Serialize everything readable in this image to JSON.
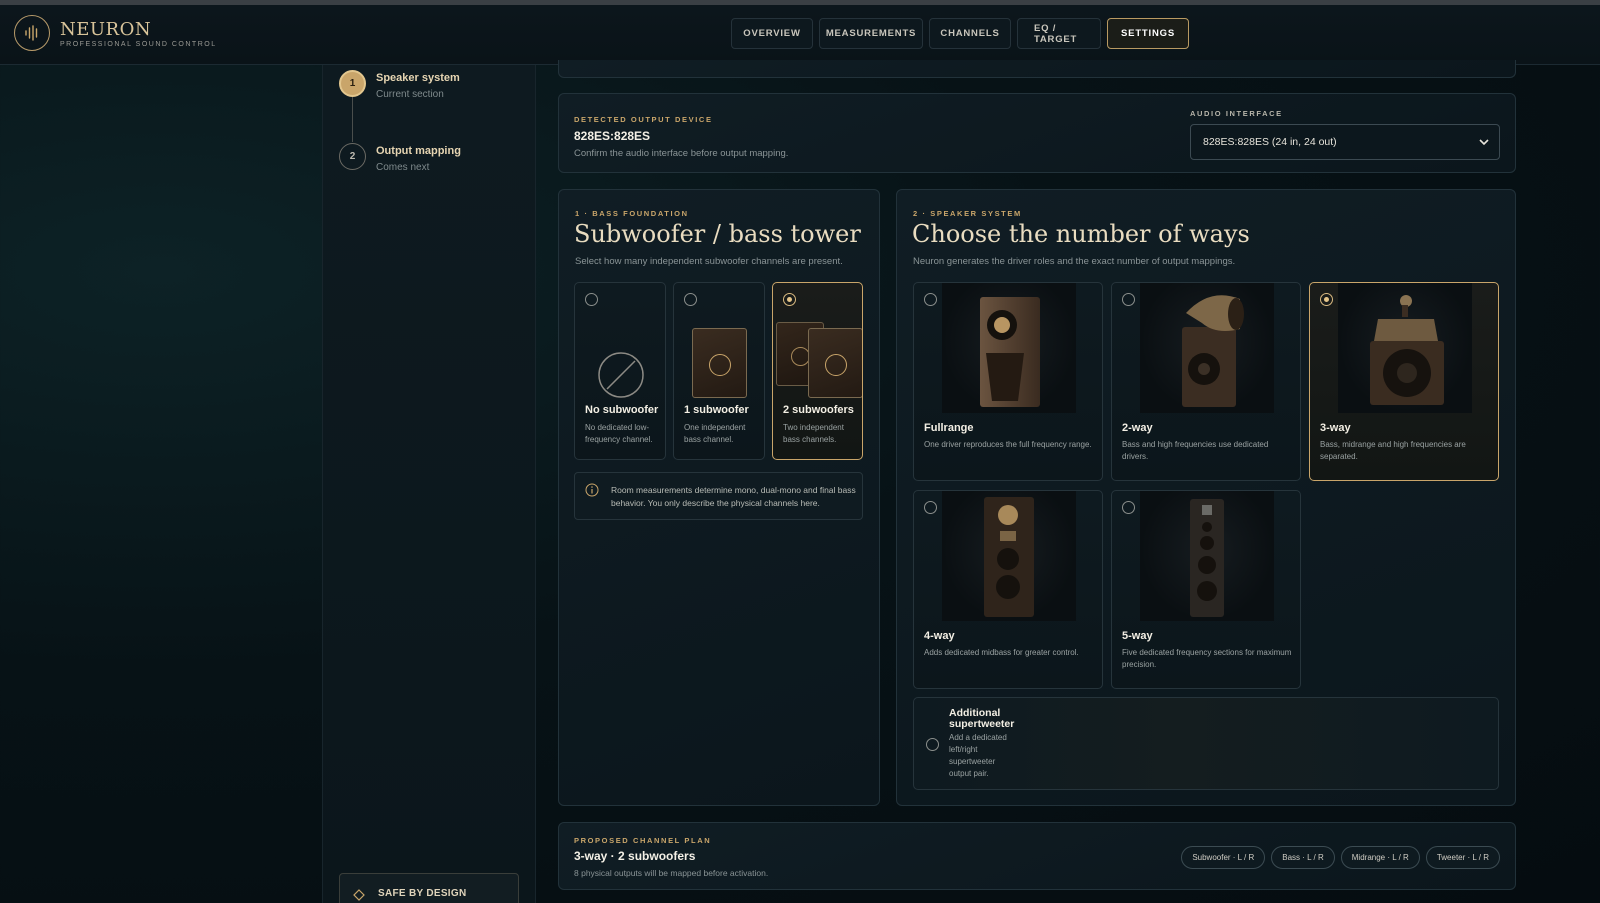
{
  "brand": {
    "name": "NEURON",
    "tagline": "PROFESSIONAL SOUND CONTROL"
  },
  "nav": {
    "tabs": [
      {
        "label": "OVERVIEW"
      },
      {
        "label": "MEASUREMENTS"
      },
      {
        "label": "CHANNELS"
      },
      {
        "label": "EQ / TARGET"
      },
      {
        "label": "SETTINGS",
        "active": true
      }
    ]
  },
  "steps": [
    {
      "number": "1",
      "title": "Speaker system",
      "subtitle": "Current section"
    },
    {
      "number": "2",
      "title": "Output mapping",
      "subtitle": "Comes next"
    }
  ],
  "safe": {
    "label": "SAFE BY DESIGN"
  },
  "device": {
    "eyebrow": "DETECTED OUTPUT DEVICE",
    "name": "828ES:828ES",
    "hint": "Confirm the audio interface before output mapping.",
    "interface_label": "AUDIO INTERFACE",
    "interface_value": "828ES:828ES (24 in, 24 out)"
  },
  "bass": {
    "eyebrow": "1 · BASS FOUNDATION",
    "title": "Subwoofer / bass tower",
    "description": "Select how many independent subwoofer channels are present.",
    "options": [
      {
        "title": "No subwoofer",
        "desc": "No dedicated low-frequency channel."
      },
      {
        "title": "1 subwoofer",
        "desc": "One independent bass channel."
      },
      {
        "title": "2 subwoofers",
        "desc": "Two independent bass channels."
      }
    ],
    "info": "Room measurements determine mono, dual-mono and final bass behavior. You only describe the physical channels here."
  },
  "speaker": {
    "eyebrow": "2 · SPEAKER SYSTEM",
    "title": "Choose the number of ways",
    "description": "Neuron generates the driver roles and the exact number of output mappings.",
    "options": [
      {
        "title": "Fullrange",
        "desc": "One driver reproduces the full frequency range."
      },
      {
        "title": "2-way",
        "desc": "Bass and high frequencies use dedicated drivers."
      },
      {
        "title": "3-way",
        "desc": "Bass, midrange and high frequencies are separated."
      },
      {
        "title": "4-way",
        "desc": "Adds dedicated midbass for greater control."
      },
      {
        "title": "5-way",
        "desc": "Five dedicated frequency sections for maximum precision."
      }
    ],
    "supertweeter": {
      "title": "Additional supertweeter",
      "desc": "Add a dedicated left/right supertweeter output pair."
    }
  },
  "plan": {
    "eyebrow": "PROPOSED CHANNEL PLAN",
    "title": "3-way · 2 subwoofers",
    "summary": "8 physical outputs will be mapped before activation.",
    "chips": [
      "Subwoofer · L / R",
      "Bass · L / R",
      "Midrange · L / R",
      "Tweeter · L / R"
    ]
  },
  "colors": {
    "accent": "#c9a56a",
    "background": "#071216",
    "panel": "#0e1a20"
  }
}
